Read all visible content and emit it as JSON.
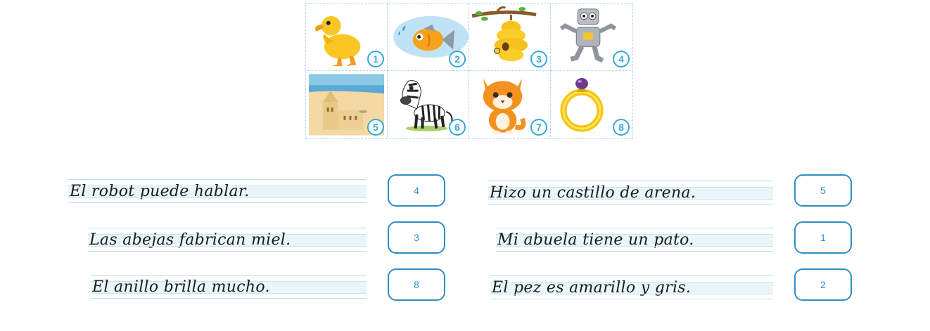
{
  "pictures": [
    {
      "number": "1",
      "icon": "duck-icon"
    },
    {
      "number": "2",
      "icon": "fish-icon"
    },
    {
      "number": "3",
      "icon": "beehive-icon"
    },
    {
      "number": "4",
      "icon": "robot-icon"
    },
    {
      "number": "5",
      "icon": "sandcastle-icon"
    },
    {
      "number": "6",
      "icon": "zebra-icon"
    },
    {
      "number": "7",
      "icon": "cat-icon"
    },
    {
      "number": "8",
      "icon": "ring-icon"
    }
  ],
  "sentences": [
    {
      "text": "El robot puede hablar.",
      "answer": "4"
    },
    {
      "text": "Las abejas fabrican miel.",
      "answer": "3"
    },
    {
      "text": "El anillo brilla mucho.",
      "answer": "8"
    },
    {
      "text": "Hizo un castillo de arena.",
      "answer": "5"
    },
    {
      "text": "Mi abuela tiene un pato.",
      "answer": "1"
    },
    {
      "text": "El pez es amarillo y gris.",
      "answer": "2"
    }
  ]
}
